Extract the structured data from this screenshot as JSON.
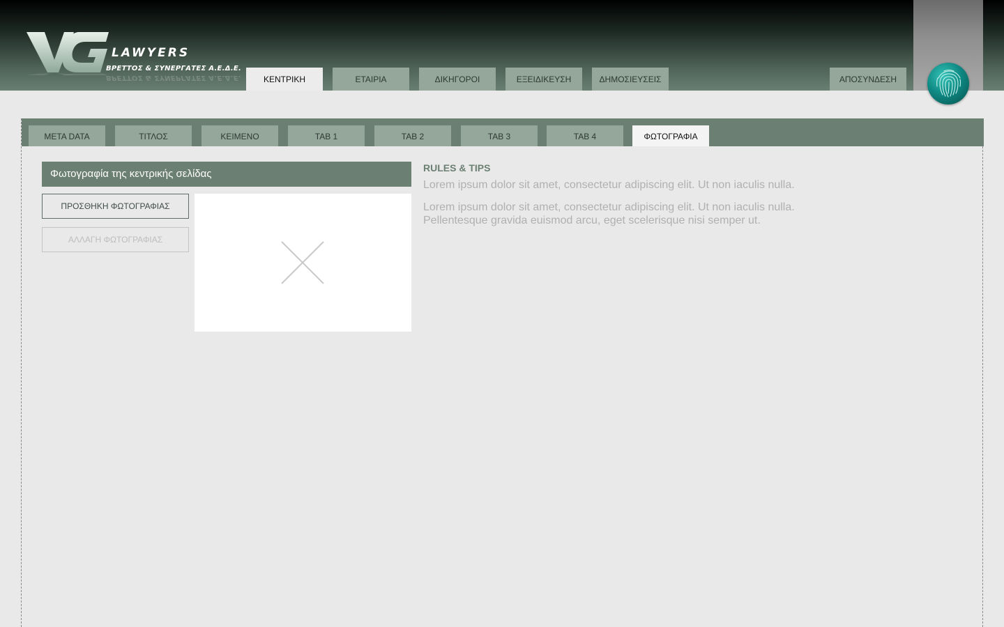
{
  "brand": {
    "title": "LAWYERS",
    "subtitle": "ΒΡΕΤΤΟΣ & ΣΥΝΕΡΓΑΤΕΣ Α.Ε.Δ.Ε.",
    "monogram": "VG",
    "colors": {
      "header_accent": "#6b7f72",
      "tab_inactive": "#95a69b",
      "fingerprint": "#0f8a84"
    }
  },
  "nav": {
    "tabs": [
      {
        "label": "ΚΕΝΤΡΙΚΗ",
        "active": true
      },
      {
        "label": "ΕΤΑΙΡΙΑ",
        "active": false
      },
      {
        "label": "ΔΙΚΗΓΟΡΟΙ",
        "active": false
      },
      {
        "label": "ΕΞΕΙΔΙΚΕΥΣΗ",
        "active": false
      },
      {
        "label": "ΔΗΜΟΣΙΕΥΣΕΙΣ",
        "active": false
      }
    ],
    "logout": "ΑΠΟΣΥΝΔΕΣΗ",
    "user_icon": "fingerprint-icon"
  },
  "subtabs": [
    {
      "label": "META DATA",
      "active": false
    },
    {
      "label": "ΤΙΤΛΟΣ",
      "active": false
    },
    {
      "label": "ΚΕΙΜΕΝΟ",
      "active": false
    },
    {
      "label": "TAB 1",
      "active": false
    },
    {
      "label": "TAB 2",
      "active": false
    },
    {
      "label": "TAB 3",
      "active": false
    },
    {
      "label": "TAB 4",
      "active": false
    },
    {
      "label": "ΦΩΤΟΓΡΑΦΙΑ",
      "active": true
    }
  ],
  "photo_section": {
    "title": "Φωτογραφία της κεντρικής σελίδας",
    "add_button": "ΠΡΟΣΘΗΚΗ ΦΩΤΟΓΡΑΦΙΑΣ",
    "change_button": "ΑΛΛΑΓΗ ΦΩΤΟΓΡΑΦΙΑΣ",
    "placeholder_icon": "image-placeholder-icon"
  },
  "rules": {
    "title": "RULES & TIPS",
    "paragraph1": "Lorem ipsum dolor sit amet, consectetur adipiscing elit. Ut non iaculis nulla.",
    "paragraph2_line1": "Lorem ipsum dolor sit amet, consectetur adipiscing elit. Ut non iaculis nulla.",
    "paragraph2_line2": "Pellentesque gravida euismod arcu, eget scelerisque nisi semper ut."
  }
}
